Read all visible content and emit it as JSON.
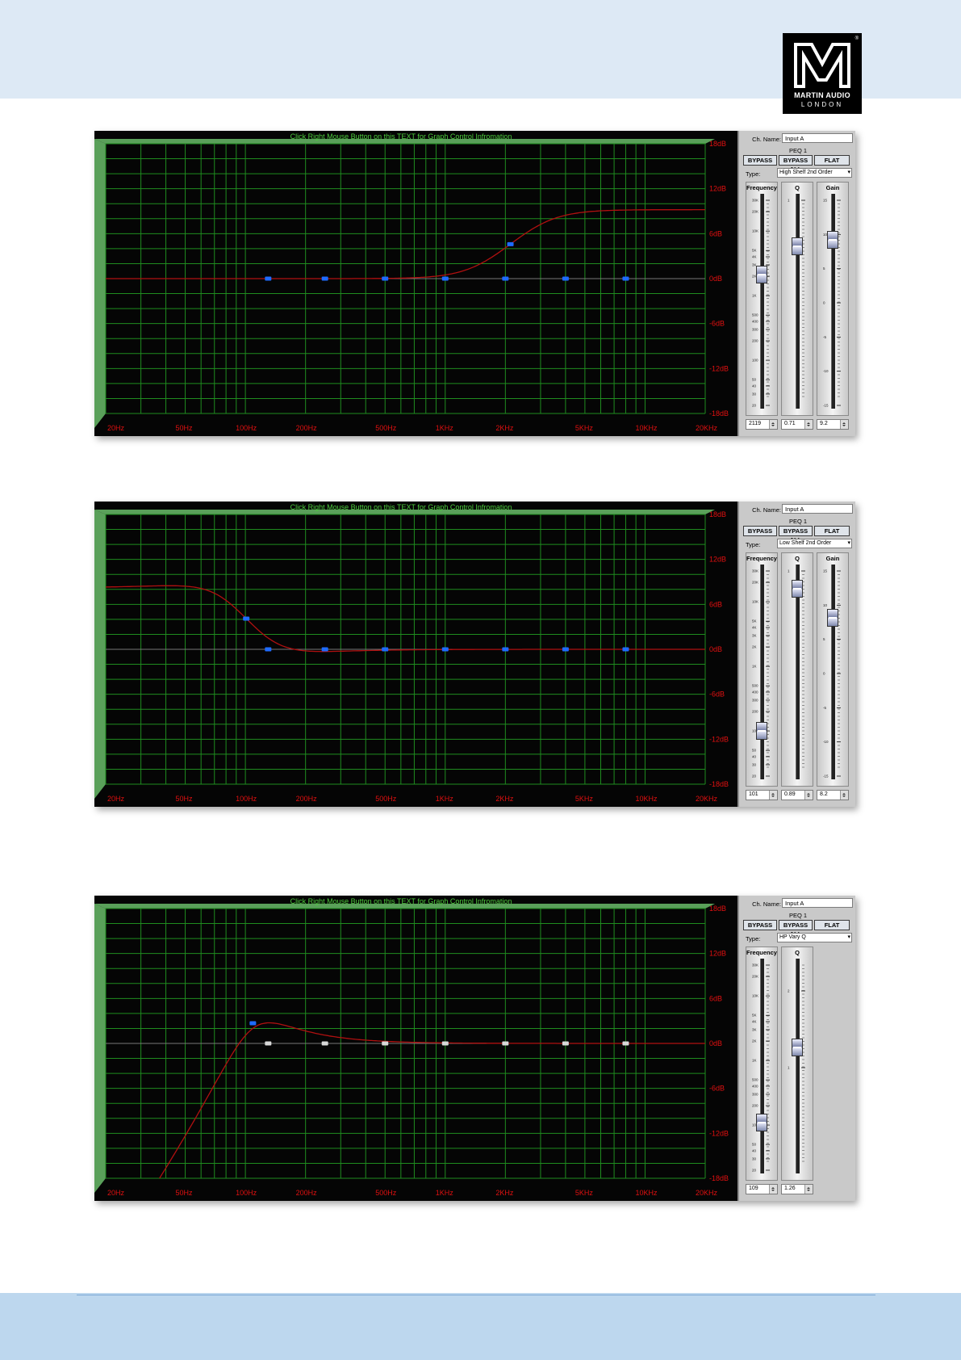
{
  "logo": {
    "line1": "MARTIN AUDIO",
    "line2": "LONDON",
    "reg": "®"
  },
  "screens": [
    {
      "graph_help": "Click Right Mouse Button on this TEXT for Graph Control Infromation",
      "y_labels": [
        "18dB",
        "12dB",
        "6dB",
        "0dB",
        "-6dB",
        "-12dB",
        "-18dB"
      ],
      "x_labels": [
        "20Hz",
        "50Hz",
        "100Hz",
        "200Hz",
        "500Hz",
        "1KHz",
        "2KHz",
        "5KHz",
        "10KHz",
        "20KHz"
      ],
      "ch_name_label": "Ch. Name:",
      "ch_name": "Input A",
      "peq_label": "PEQ 1",
      "buttons": {
        "bypass": "BYPASS",
        "bypass_all": "BYPASS ALL",
        "flat": "FLAT"
      },
      "type_label": "Type:",
      "type_value": "High Shelf 2nd Order",
      "faders": [
        {
          "title": "Frequency",
          "value": "2119",
          "scale": "freq"
        },
        {
          "title": "Q",
          "value": "0.71",
          "scale": "q"
        },
        {
          "title": "Gain",
          "value": "9.2",
          "scale": "gain"
        }
      ],
      "curve": {
        "kind": "high_shelf",
        "freq_hz": 2119,
        "q": 0.71,
        "gain_db": 9.2
      },
      "handles_hz": [
        130,
        250,
        500,
        1000,
        2000,
        4000,
        8000
      ],
      "active_handle": 4,
      "handle_color": "#1e6bff",
      "inactive_handle_color": "#1e6bff"
    },
    {
      "graph_help": "Click Right Mouse Button on this TEXT for Graph Control Infromation",
      "y_labels": [
        "18dB",
        "12dB",
        "6dB",
        "0dB",
        "-6dB",
        "-12dB",
        "-18dB"
      ],
      "x_labels": [
        "20Hz",
        "50Hz",
        "100Hz",
        "200Hz",
        "500Hz",
        "1KHz",
        "2KHz",
        "5KHz",
        "10KHz",
        "20KHz"
      ],
      "ch_name_label": "Ch. Name:",
      "ch_name": "Input A",
      "peq_label": "PEQ 1",
      "buttons": {
        "bypass": "BYPASS",
        "bypass_all": "BYPASS ALL",
        "flat": "FLAT"
      },
      "type_label": "Type:",
      "type_value": "Low Shelf 2nd Order",
      "faders": [
        {
          "title": "Frequency",
          "value": "101",
          "scale": "freq"
        },
        {
          "title": "Q",
          "value": "0.89",
          "scale": "q"
        },
        {
          "title": "Gain",
          "value": "8.2",
          "scale": "gain"
        }
      ],
      "curve": {
        "kind": "low_shelf",
        "freq_hz": 101,
        "q": 0.89,
        "gain_db": 8.2
      },
      "handles_hz": [
        130,
        250,
        500,
        1000,
        2000,
        4000,
        8000
      ],
      "active_handle": 0,
      "handle_color": "#1e6bff",
      "inactive_handle_color": "#1e6bff"
    },
    {
      "graph_help": "Click Right Mouse Button on this TEXT for Graph Control Infromation",
      "y_labels": [
        "18dB",
        "12dB",
        "6dB",
        "0dB",
        "-6dB",
        "-12dB",
        "-18dB"
      ],
      "x_labels": [
        "20Hz",
        "50Hz",
        "100Hz",
        "200Hz",
        "500Hz",
        "1KHz",
        "2KHz",
        "5KHz",
        "10KHz",
        "20KHz"
      ],
      "ch_name_label": "Ch. Name:",
      "ch_name": "Input A",
      "peq_label": "PEQ 1",
      "buttons": {
        "bypass": "BYPASS",
        "bypass_all": "BYPASS ALL",
        "flat": "FLAT"
      },
      "type_label": "Type:",
      "type_value": "HP Vary Q",
      "faders": [
        {
          "title": "Frequency",
          "value": "109",
          "scale": "freq"
        },
        {
          "title": "Q",
          "value": "1.26",
          "scale": "q2"
        }
      ],
      "curve": {
        "kind": "highpass",
        "freq_hz": 109,
        "q": 1.26,
        "gain_db": 0
      },
      "handles_hz": [
        130,
        250,
        500,
        1000,
        2000,
        4000,
        8000
      ],
      "active_handle": 0,
      "handle_color": "#1e6bff",
      "inactive_handle_color": "#d8d8d8"
    }
  ],
  "colors": {
    "grid": "#1f8c1f",
    "axis_label": "#e01010",
    "curve": "#b01010",
    "bevel": "#5aa05a"
  }
}
